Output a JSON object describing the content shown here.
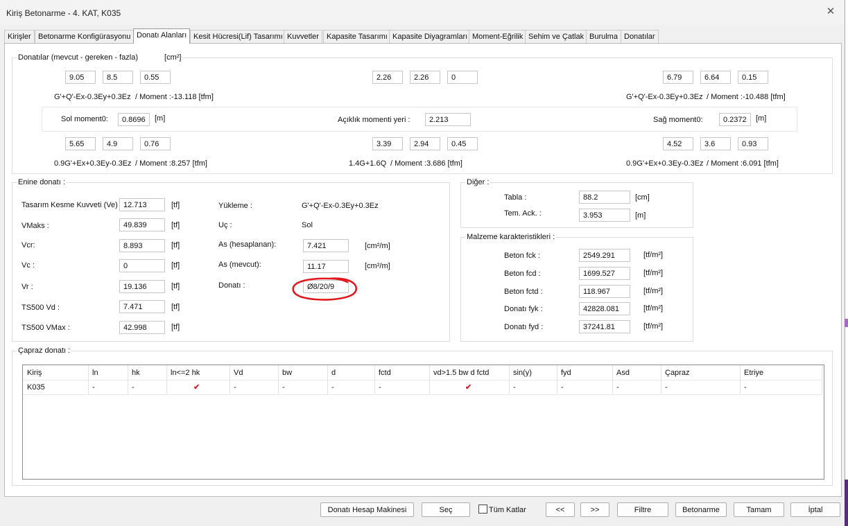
{
  "window": {
    "title": "Kiriş Betonarme - 4. KAT, K035"
  },
  "tabs": [
    "Kirişler",
    "Betonarme Konfigürasyonu",
    "Donatı Alanları",
    "Kesit Hücresi(Lif) Tasarımı",
    "Kuvvetler",
    "Kapasite Tasarımı",
    "Kapasite Diyagramları",
    "Moment-Eğrilik",
    "Sehim ve Çatlak",
    "Burulma",
    "Donatılar"
  ],
  "active_tab": "Donatı Alanları",
  "donatilar": {
    "title": "Donatılar (mevcut - gereken - fazla)",
    "unit": "[cm²]",
    "top_left": {
      "v1": "9.05",
      "v2": "8.5",
      "v3": "0.55",
      "combo": "G'+Q'-Ex-0.3Ey+0.3Ez",
      "moment": "/ Moment :-13.118 [tfm]"
    },
    "top_mid": {
      "v1": "2.26",
      "v2": "2.26",
      "v3": "0"
    },
    "top_right": {
      "v1": "6.79",
      "v2": "6.64",
      "v3": "0.15",
      "combo": "G'+Q'-Ex-0.3Ey+0.3Ez",
      "moment": "/ Moment :-10.488 [tfm]"
    },
    "sol_moment_label": "Sol moment0:",
    "sol_moment_value": "0.8696",
    "sol_moment_unit": "[m]",
    "aciklik_label": "Açıklık momenti yeri :",
    "aciklik_value": "2.213",
    "sag_moment_label": "Sağ moment0:",
    "sag_moment_value": "0.2372",
    "sag_moment_unit": "[m]",
    "bot_left": {
      "v1": "5.65",
      "v2": "4.9",
      "v3": "0.76",
      "combo": "0.9G'+Ex+0.3Ey-0.3Ez",
      "moment": "/ Moment :8.257 [tfm]"
    },
    "bot_mid": {
      "v1": "3.39",
      "v2": "2.94",
      "v3": "0.45",
      "combo": "1.4G+1.6Q",
      "moment": "/ Moment :3.686 [tfm]"
    },
    "bot_right": {
      "v1": "4.52",
      "v2": "3.6",
      "v3": "0.93",
      "combo": "0.9G'+Ex+0.3Ey-0.3Ez",
      "moment": "/ Moment :6.091 [tfm]"
    }
  },
  "enine": {
    "title": "Enine donatı :",
    "rows": [
      {
        "label": "Tasarım Kesme Kuvveti (Ve)",
        "value": "12.713",
        "unit": "[tf]"
      },
      {
        "label": "VMaks :",
        "value": "49.839",
        "unit": "[tf]"
      },
      {
        "label": "Vcr:",
        "value": "8.893",
        "unit": "[tf]"
      },
      {
        "label": "Vc :",
        "value": "0",
        "unit": "[tf]"
      },
      {
        "label": "Vr :",
        "value": "19.136",
        "unit": "[tf]"
      },
      {
        "label": "TS500 Vd :",
        "value": "7.471",
        "unit": "[tf]"
      },
      {
        "label": "TS500 VMax :",
        "value": "42.998",
        "unit": "[tf]"
      }
    ],
    "yukleme_label": "Yükleme :",
    "yukleme_value": "G'+Q'-Ex-0.3Ey+0.3Ez",
    "uc_label": "Uç :",
    "uc_value": "Sol",
    "as_hesap_label": "As (hesaplanan):",
    "as_hesap_value": "7.421",
    "as_hesap_unit": "[cm²/m]",
    "as_mevcut_label": "As (mevcut):",
    "as_mevcut_value": "11.17",
    "as_mevcut_unit": "[cm²/m]",
    "donati_label": "Donatı :",
    "donati_value": "Ø8/20/9"
  },
  "diger": {
    "title": "Diğer :",
    "tabla_label": "Tabla :",
    "tabla_value": "88.2",
    "tabla_unit": "[cm]",
    "tem_label": "Tem. Ack. :",
    "tem_value": "3.953",
    "tem_unit": "[m]"
  },
  "malzeme": {
    "title": "Malzeme karakteristikleri :",
    "rows": [
      {
        "label": "Beton fck :",
        "value": "2549.291",
        "unit": "[tf/m²]"
      },
      {
        "label": "Beton fcd :",
        "value": "1699.527",
        "unit": "[tf/m²]"
      },
      {
        "label": "Beton fctd :",
        "value": "118.967",
        "unit": "[tf/m²]"
      },
      {
        "label": "Donatı fyk :",
        "value": "42828.081",
        "unit": "[tf/m²]"
      },
      {
        "label": "Donatı fyd :",
        "value": "37241.81",
        "unit": "[tf/m²]"
      }
    ]
  },
  "capraz": {
    "title": "Çapraz donatı :",
    "columns": [
      "Kiriş",
      "ln",
      "hk",
      "ln<=2 hk",
      "Vd",
      "bw",
      "d",
      "fctd",
      "vd>1.5 bw d fctd",
      "sin(y)",
      "fyd",
      "Asd",
      "Çapraz",
      "Etriye"
    ],
    "row": [
      "K035",
      "-",
      "-",
      "✔",
      "-",
      "-",
      "-",
      "-",
      "✔",
      "-",
      "-",
      "-",
      "-",
      "-"
    ]
  },
  "buttons": {
    "hesap": "Donatı Hesap Makinesi",
    "sec": "Seç",
    "tum_katlar": "Tüm Katlar",
    "prev": "<<",
    "next": ">>",
    "filtre": "Filtre",
    "betonarme": "Betonarme",
    "tamam": "Tamam",
    "iptal": "İptal"
  },
  "colors": {
    "annotation": "#e0191f",
    "check": "#d21f2f",
    "desktop_strip": "#a66ac6"
  }
}
